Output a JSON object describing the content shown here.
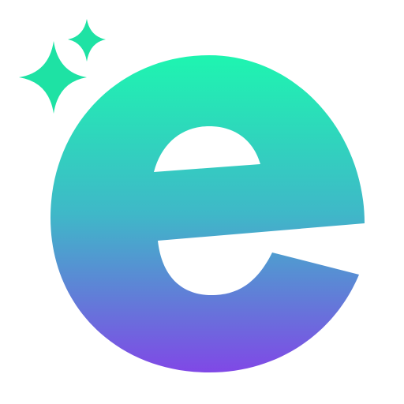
{
  "logo": {
    "icon_name": "sparkle-e-logo-icon",
    "sparkle_icon_name": "sparkle-icon",
    "colors": {
      "gradient_top": "#1ef5b0",
      "gradient_mid": "#3fb8c8",
      "gradient_bottom": "#8048e6",
      "sparkle": "#1ee2a4",
      "background": "#ffffff"
    }
  }
}
